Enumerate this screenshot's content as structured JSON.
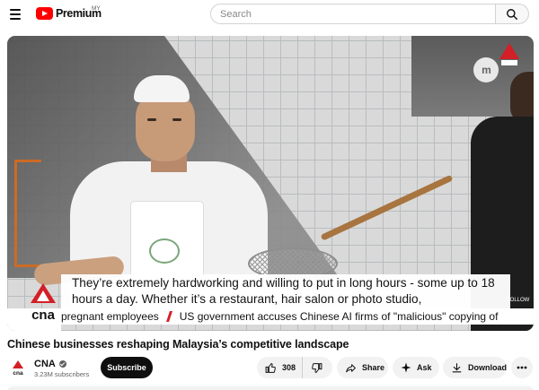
{
  "header": {
    "logo_text": "Premium",
    "country_code": "MY",
    "search_placeholder": "Search"
  },
  "video": {
    "caption": "They’re extremely hardworking and willing to put in long hours - some up to 18 hours a day. Whether it’s a restaurant, hair salon or photo studio,",
    "logo_text": "cna",
    "follow_label": "FOLLOW",
    "ticker_items": [
      "pregnant employees",
      "US government accuses Chinese AI firms of \"malicious\" copying of"
    ]
  },
  "title": "Chinese businesses reshaping Malaysia’s competitive landscape",
  "channel": {
    "name": "CNA",
    "avatar_text": "cna",
    "subscribers": "3.23M subscribers",
    "subscribe_label": "Subscribe"
  },
  "actions": {
    "likes": "308",
    "share": "Share",
    "ask": "Ask",
    "download": "Download"
  },
  "colors": {
    "brand_red": "#ff0000",
    "cna_red": "#d31f26",
    "button_dark": "#0f0f0f",
    "pill_bg": "#f2f2f2"
  },
  "icons": [
    "menu-icon",
    "youtube-logo-icon",
    "search-icon",
    "verified-icon",
    "like-icon",
    "dislike-icon",
    "share-icon",
    "ask-sparkle-icon",
    "download-icon",
    "more-icon"
  ]
}
